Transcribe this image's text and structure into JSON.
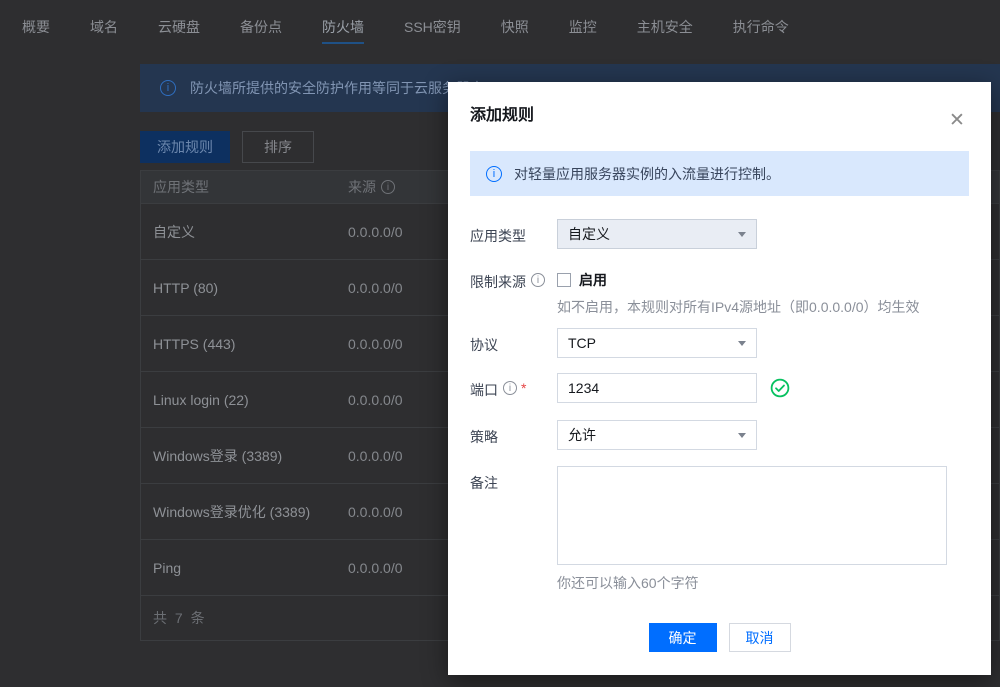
{
  "nav": {
    "tabs": [
      "概要",
      "域名",
      "云硬盘",
      "备份点",
      "防火墙",
      "SSH密钥",
      "快照",
      "监控",
      "主机安全",
      "执行命令"
    ],
    "active_tab": "防火墙"
  },
  "page": {
    "banner_text": "防火墙所提供的安全防护作用等同于云服务器中",
    "add_rule_label": "添加规则",
    "sort_label": "排序",
    "table": {
      "columns": {
        "app_type": "应用类型",
        "source": "来源"
      },
      "rows": [
        {
          "app_type": "自定义",
          "source": "0.0.0.0/0"
        },
        {
          "app_type": "HTTP (80)",
          "source": "0.0.0.0/0"
        },
        {
          "app_type": "HTTPS (443)",
          "source": "0.0.0.0/0"
        },
        {
          "app_type": "Linux login (22)",
          "source": "0.0.0.0/0"
        },
        {
          "app_type": "Windows登录 (3389)",
          "source": "0.0.0.0/0"
        },
        {
          "app_type": "Windows登录优化 (3389)",
          "source": "0.0.0.0/0"
        },
        {
          "app_type": "Ping",
          "source": "0.0.0.0/0"
        }
      ],
      "footer": "共 7 条"
    }
  },
  "modal": {
    "title": "添加规则",
    "banner_text": "对轻量应用服务器实例的入流量进行控制。",
    "fields": {
      "app_type": {
        "label": "应用类型",
        "value": "自定义"
      },
      "limit_source": {
        "label": "限制来源",
        "checkbox_label": "启用",
        "checked": false,
        "hint": "如不启用，本规则对所有IPv4源地址（即0.0.0.0/0）均生效"
      },
      "protocol": {
        "label": "协议",
        "value": "TCP"
      },
      "port": {
        "label": "端口",
        "required_mark": "*",
        "value": "1234",
        "status": "valid"
      },
      "policy": {
        "label": "策略",
        "value": "允许"
      },
      "remark": {
        "label": "备注",
        "value": "",
        "counter_hint": "你还可以输入60个字符"
      }
    },
    "confirm_label": "确定",
    "cancel_label": "取消"
  },
  "icons": {
    "info_glyph": "i",
    "close_glyph": "✕"
  },
  "colors": {
    "accent_blue": "#006eff",
    "success_green": "#07c160",
    "required_red": "#e54545",
    "modal_banner_bg": "#d9e8fd",
    "dim_background": "#2e2e30"
  }
}
